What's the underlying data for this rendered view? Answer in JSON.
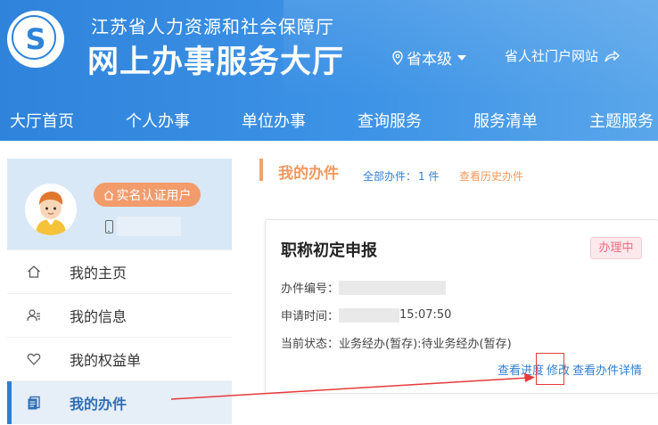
{
  "header": {
    "org_name": "江苏省人力资源和社会保障厅",
    "site_title": "网上办事服务大厅",
    "region": "省本级",
    "portal_link": "省人社门户网站"
  },
  "nav": {
    "items": [
      {
        "label": "大厅首页"
      },
      {
        "label": "个人办事"
      },
      {
        "label": "单位办事"
      },
      {
        "label": "查询服务"
      },
      {
        "label": "服务清单"
      },
      {
        "label": "主题服务"
      }
    ]
  },
  "profile": {
    "badge": "实名认证用户"
  },
  "menu": {
    "items": [
      {
        "label": "我的主页",
        "icon": "home-icon"
      },
      {
        "label": "我的信息",
        "icon": "user-info-icon"
      },
      {
        "label": "我的权益单",
        "icon": "heart-icon"
      },
      {
        "label": "我的办件",
        "icon": "documents-icon",
        "active": true
      }
    ]
  },
  "main": {
    "section_title": "我的办件",
    "count_label": "全部办件：",
    "count_value": "1 件",
    "history_link": "查看历史办件"
  },
  "card": {
    "title": "职称初定申报",
    "status": "办理中",
    "id_label": "办件编号：",
    "time_label": "申请时间：",
    "time_value_visible": "15:07:50",
    "state_label": "当前状态：",
    "state_value": "业务经办(暂存):待业务经办(暂存)",
    "actions": {
      "progress": "查看进度",
      "modify": "修改",
      "details": "查看办件详情"
    }
  },
  "colors": {
    "header_blue": "#3a8fe3",
    "accent_orange": "#f0995d",
    "link_blue": "#2f7fd0",
    "status_pink": "#ed6b80",
    "annotation_red": "#e53b3b"
  }
}
